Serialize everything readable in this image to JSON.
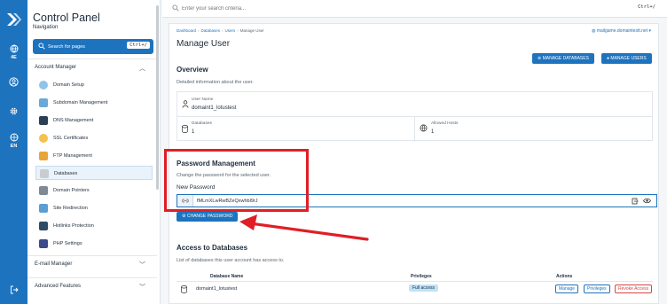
{
  "colors": {
    "accent": "#1e73be",
    "highlight": "#e01e26",
    "badge": "#bfe3f7"
  },
  "rail": {
    "badge": "4E",
    "language": "EN",
    "icons": [
      "logo-icon",
      "globe-icon",
      "user-icon",
      "gear-icon",
      "language-icon",
      "logout-icon"
    ]
  },
  "sidebar": {
    "title": "Control Panel",
    "subtitle": "Navigation",
    "search_label": "Search for pages",
    "search_shortcut": "Ctrl+/",
    "account_manager": "Account Manager",
    "items": [
      {
        "label": "Domain Setup",
        "icon": "globe-icon"
      },
      {
        "label": "Subdomain Management",
        "icon": "subdomain-icon"
      },
      {
        "label": "DNS Management",
        "icon": "dns-icon"
      },
      {
        "label": "SSL Certificates",
        "icon": "ssl-icon"
      },
      {
        "label": "FTP Management",
        "icon": "ftp-icon"
      },
      {
        "label": "Databases",
        "icon": "database-icon"
      },
      {
        "label": "Domain Pointers",
        "icon": "pointer-icon"
      },
      {
        "label": "Site Redirection",
        "icon": "redirect-icon"
      },
      {
        "label": "Hotlinks Protection",
        "icon": "hotlink-icon"
      },
      {
        "label": "PHP Settings",
        "icon": "php-icon"
      }
    ],
    "email_manager": "E-mail Manager",
    "advanced_features": "Advanced Features"
  },
  "topbar": {
    "search_placeholder": "Enter your search criteria...",
    "shortcut": "Ctrl+/"
  },
  "breadcrumb": [
    "Dashboard",
    "Databases",
    "Users",
    "Manage User"
  ],
  "domain_selector": "mailgame.domaintestt.net",
  "page_title": "Manage User",
  "buttons": {
    "manage_databases": "MANAGE DATABASES",
    "manage_users": "MANAGE USERS",
    "change_password": "CHANGE PASSWORD"
  },
  "overview": {
    "title": "Overview",
    "description": "Detailed information about the user.",
    "user_name_label": "User Name",
    "user_name": "domaint1_lotustest",
    "databases_label": "Databases",
    "databases_value": "1",
    "allowed_hosts_label": "Allowed Hosts",
    "allowed_hosts_value": "1"
  },
  "password": {
    "title": "Password Management",
    "description": "Change the password for the selected user.",
    "field_label": "New Password",
    "value": "fMLmXLwRwBZeQxwhbl9rJ"
  },
  "access": {
    "title": "Access to Databases",
    "description": "List of databases this user account has access to.",
    "columns": [
      "Database Name",
      "Privileges",
      "Actions"
    ],
    "rows": [
      {
        "name": "domaint1_lotustest",
        "privilege": "Full access",
        "actions": [
          "Manage",
          "Privileges",
          "Revoke Access"
        ]
      }
    ]
  }
}
